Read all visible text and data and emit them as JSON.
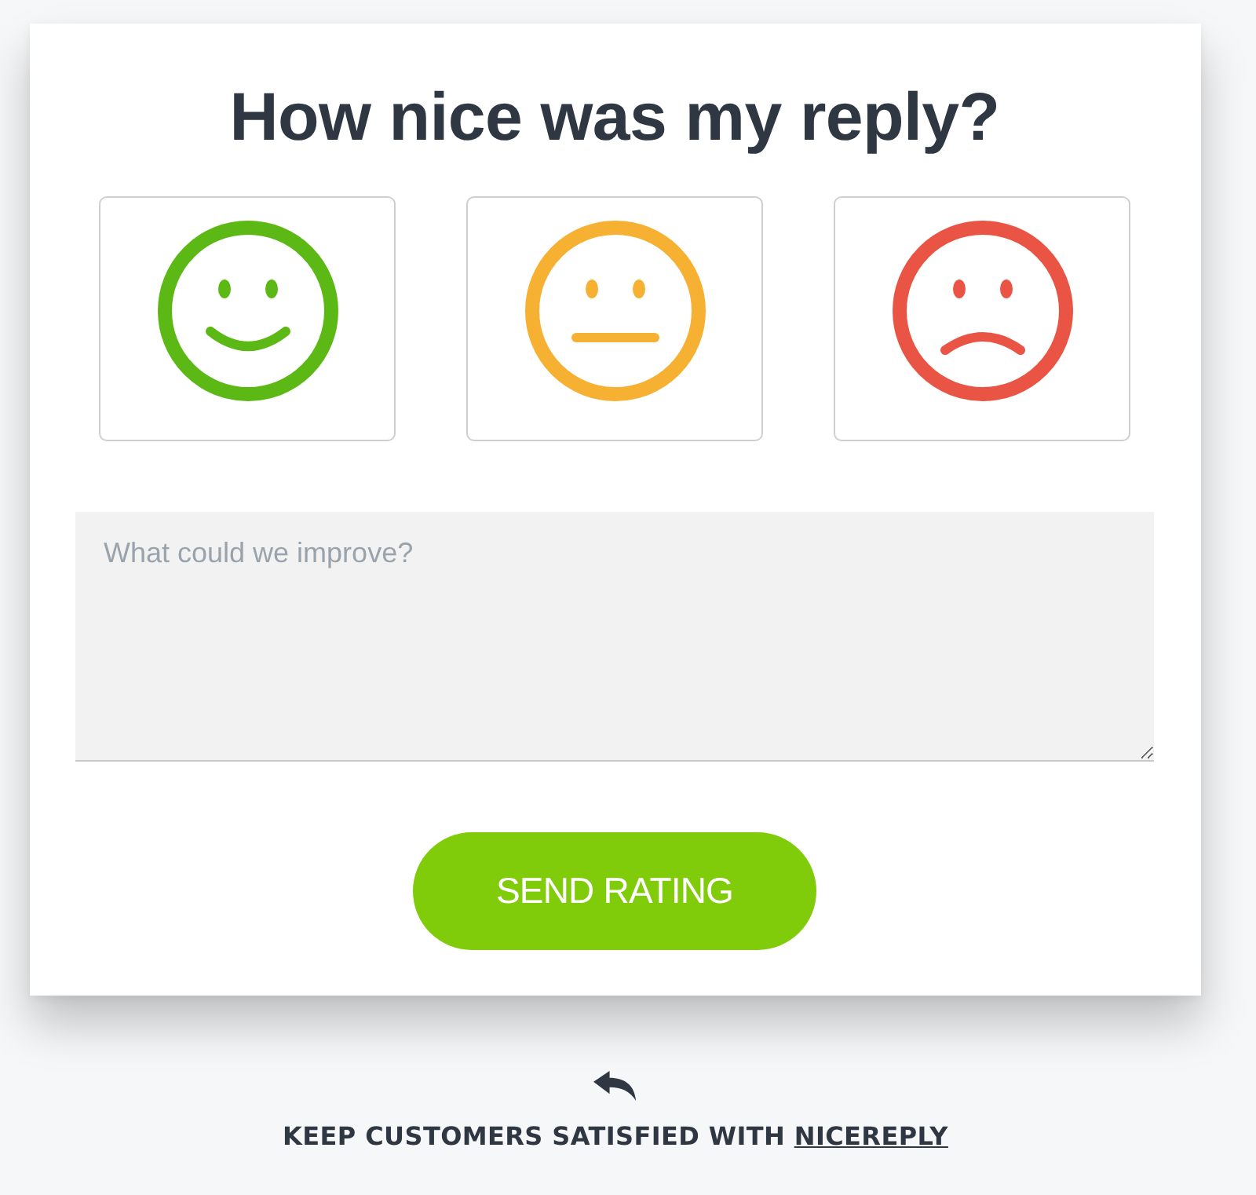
{
  "title": "How nice was my reply?",
  "faces": [
    {
      "kind": "happy",
      "color": "#5cb814"
    },
    {
      "kind": "neutral",
      "color": "#f6b133"
    },
    {
      "kind": "sad",
      "color": "#e95444"
    }
  ],
  "comment": {
    "placeholder": "What could we improve?"
  },
  "submit": {
    "label": "SEND RATING"
  },
  "footer": {
    "text": "KEEP CUSTOMERS SATISFIED WITH",
    "link": "NICEREPLY"
  }
}
